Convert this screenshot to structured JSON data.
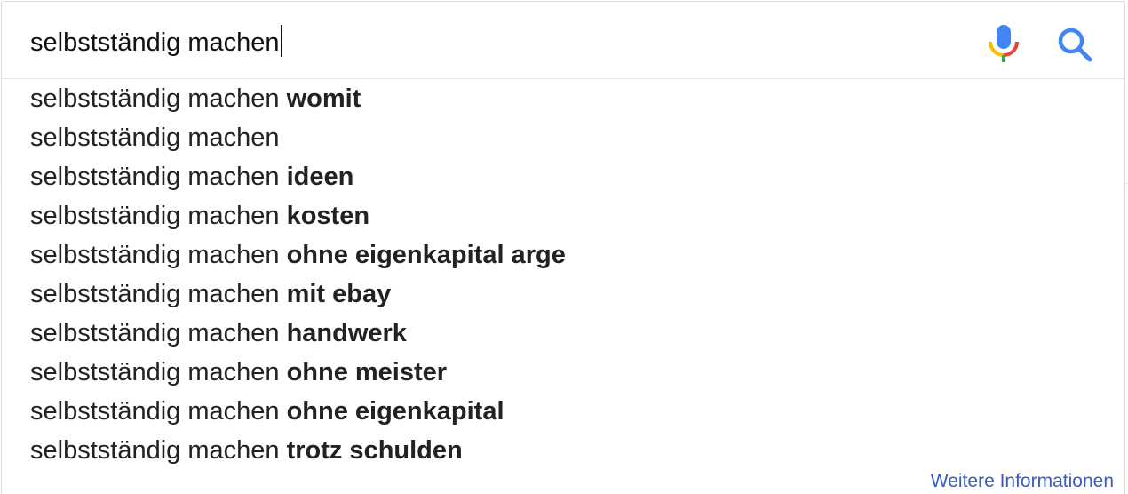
{
  "search": {
    "query": "selbstständig machen"
  },
  "icons": {
    "mic": "microphone-icon",
    "search": "magnifier-icon"
  },
  "colors": {
    "mic_blue": "#4285f4",
    "mic_red": "#ea4335",
    "mic_yellow": "#fbbc05",
    "mic_green": "#34a853",
    "search_icon": "#4285f4",
    "link": "#3b5bc4"
  },
  "suggestions": [
    {
      "prefix": "selbstständig machen",
      "suffix": "womit"
    },
    {
      "prefix": "selbstständig machen",
      "suffix": ""
    },
    {
      "prefix": "selbstständig machen",
      "suffix": "ideen"
    },
    {
      "prefix": "selbstständig machen",
      "suffix": "kosten"
    },
    {
      "prefix": "selbstständig machen",
      "suffix": "ohne eigenkapital arge"
    },
    {
      "prefix": "selbstständig machen",
      "suffix": "mit ebay"
    },
    {
      "prefix": "selbstständig machen",
      "suffix": "handwerk"
    },
    {
      "prefix": "selbstständig machen",
      "suffix": "ohne meister"
    },
    {
      "prefix": "selbstständig machen",
      "suffix": "ohne eigenkapital"
    },
    {
      "prefix": "selbstständig machen",
      "suffix": "trotz schulden"
    }
  ],
  "footer": {
    "more_info": "Weitere Informationen"
  }
}
